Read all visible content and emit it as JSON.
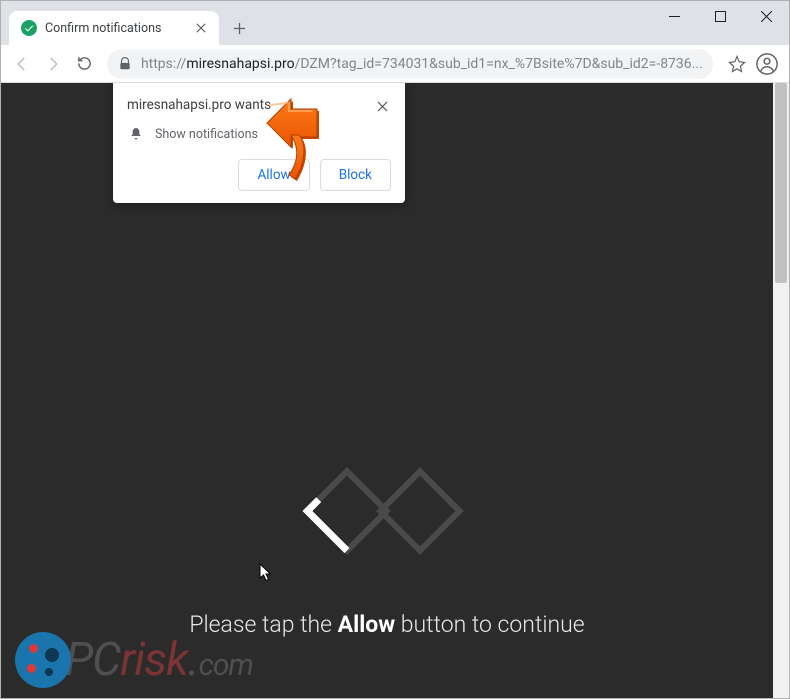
{
  "window": {
    "tab_title": "Confirm notifications"
  },
  "url": {
    "scheme": "https://",
    "host": "miresnahapsi.pro",
    "path": "/DZM?tag_id=734031&sub_id1=nx_%7Bsite%7D&sub_id2=-8736..."
  },
  "notification": {
    "title_prefix": "miresnahapsi.pro wants",
    "subtitle": "Show notifications",
    "allow": "Allow",
    "block": "Block"
  },
  "page": {
    "msg_before": "Please tap the ",
    "msg_bold": "Allow",
    "msg_after": " button to continue"
  },
  "watermark": {
    "pc": "PC",
    "risk": "risk",
    "dot": ".",
    "com": "com"
  }
}
